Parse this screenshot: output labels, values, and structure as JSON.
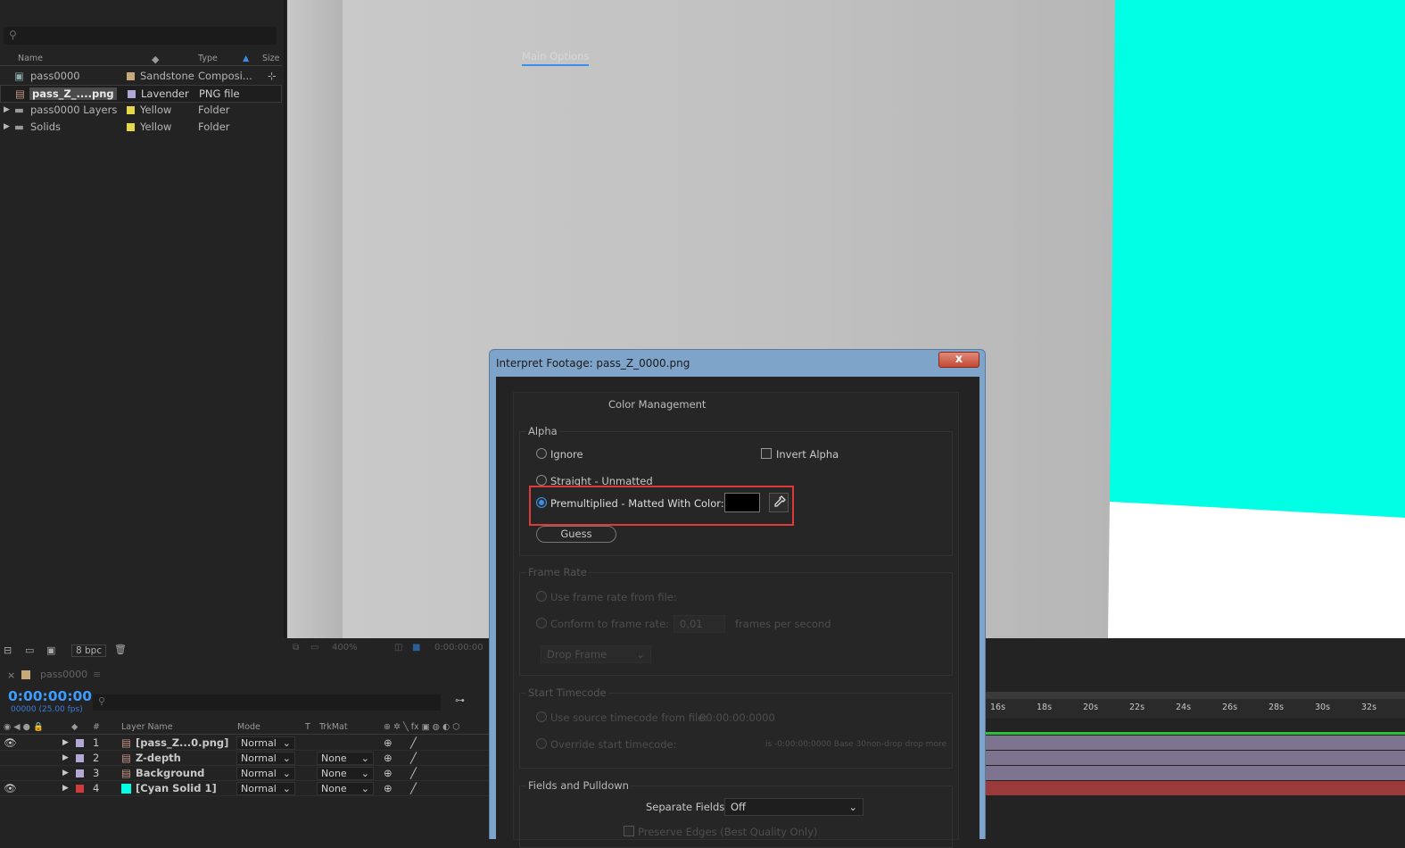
{
  "project": {
    "columns": {
      "name": "Name",
      "type": "Type",
      "size": "Size"
    },
    "items": [
      {
        "name": "pass0000",
        "label": "Sandstone",
        "type": "Composi...",
        "label_color": "#c5a97a"
      },
      {
        "name": "pass_Z_....png",
        "label": "Lavender",
        "type": "PNG file",
        "label_color": "#b4a7d6"
      },
      {
        "name": "pass0000 Layers",
        "label": "Yellow",
        "type": "Folder",
        "label_color": "#e6d64a"
      },
      {
        "name": "Solids",
        "label": "Yellow",
        "type": "Folder",
        "label_color": "#e6d64a"
      }
    ],
    "bpc": "8 bpc"
  },
  "viewer": {
    "zoom": "400%",
    "time": "0:00:00:00"
  },
  "timeline": {
    "comp_tab": "pass0000",
    "timecode": "0:00:00:00",
    "fps": "00000 (25.00 fps)",
    "columns": {
      "num": "#",
      "layer_name": "Layer Name",
      "mode": "Mode",
      "t": "T",
      "trkmat": "TrkMat"
    },
    "layers": [
      {
        "num": "1",
        "name": "[pass_Z...0.png]",
        "mode": "Normal",
        "trkmat": "",
        "color": "#b4a7d6"
      },
      {
        "num": "2",
        "name": "Z-depth",
        "mode": "Normal",
        "trkmat": "None",
        "color": "#b4a7d6"
      },
      {
        "num": "3",
        "name": "Background",
        "mode": "Normal",
        "trkmat": "None",
        "color": "#b4a7d6"
      },
      {
        "num": "4",
        "name": "[Cyan Solid 1]",
        "mode": "Normal",
        "trkmat": "None",
        "color": "#d03a3a"
      }
    ],
    "ruler": [
      "16s",
      "18s",
      "20s",
      "22s",
      "24s",
      "26s",
      "28s",
      "30s",
      "32s"
    ]
  },
  "dialog": {
    "title": "Interpret Footage: pass_Z_0000.png",
    "close": "x",
    "tabs": [
      "Main Options",
      "Color Management"
    ],
    "alpha": {
      "title": "Alpha",
      "ignore": "Ignore",
      "invert": "Invert Alpha",
      "straight": "Straight - Unmatted",
      "premult": "Premultiplied - Matted With Color:",
      "matte_color": "#000000",
      "guess": "Guess"
    },
    "frame_rate": {
      "title": "Frame Rate",
      "use_file": "Use frame rate from file:",
      "conform": "Conform to frame rate:",
      "value": "0,01",
      "unit": "frames per second",
      "drop": "Drop Frame"
    },
    "start_timecode": {
      "title": "Start Timecode",
      "use_source": "Use source timecode from file:",
      "source_value": "00:00:00:0000",
      "override": "Override start timecode:",
      "override_note": "is -0:00:00:0000  Base 30non-drop drop more"
    },
    "fields": {
      "title": "Fields and Pulldown",
      "separate": "Separate Fields:",
      "separate_value": "Off",
      "preserve": "Preserve Edges (Best Quality Only)"
    }
  },
  "colors": {
    "accent": "#3d9cff",
    "cyan": "#00ffe4",
    "highlight": "#e0393a"
  }
}
